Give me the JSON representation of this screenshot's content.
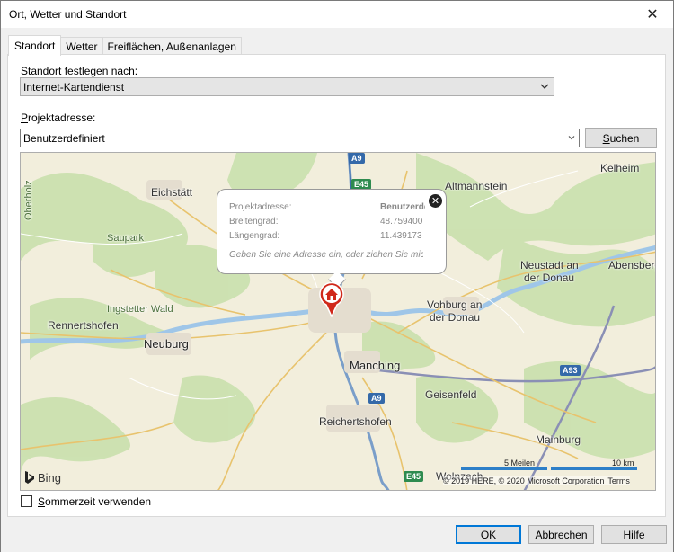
{
  "window": {
    "title": "Ort, Wetter und Standort",
    "close_glyph": "✕"
  },
  "tabs": [
    {
      "label": "Standort",
      "active": true
    },
    {
      "label": "Wetter",
      "active": false
    },
    {
      "label": "Freiflächen, Außenanlagen",
      "active": false
    }
  ],
  "location_method": {
    "label": "Standort festlegen nach:",
    "value": "Internet-Kartendienst"
  },
  "project_address": {
    "label_prefix": "P",
    "label_rest": "rojektadresse:",
    "value": "Benutzerdefiniert",
    "search_button_prefix": "S",
    "search_button_rest": "uchen"
  },
  "map": {
    "provider": "Bing",
    "places": {
      "eichstaett": "Eichstätt",
      "saupark": "Saupark",
      "oberholz": "Oberholz",
      "ingstetter_wald": "Ingstetter Wald",
      "rennertshofen": "Rennertshofen",
      "neuburg": "Neuburg",
      "altmannstein": "Altmannstein",
      "kelheim": "Kelheim",
      "neustadt_1": "Neustadt an",
      "neustadt_2": "der Donau",
      "abensberg": "Abensberg",
      "vohburg_1": "Vohburg an",
      "vohburg_2": "der Donau",
      "manching": "Manching",
      "geisenfeld": "Geisenfeld",
      "reichertshofen": "Reichertshofen",
      "mainburg": "Mainburg",
      "wolnzach": "Wolnzach"
    },
    "shields": {
      "a9_top": "A9",
      "e45_top": "E45",
      "a9_mid": "A9",
      "a9_low": "A9",
      "a93": "A93",
      "e45_bottom": "E45"
    },
    "popup": {
      "address_label": "Projektadresse:",
      "address_value": "Benutzerdefiniert",
      "lat_label": "Breitengrad:",
      "lat_value": "48.759400",
      "lon_label": "Längengrad:",
      "lon_value": "11.439173",
      "hint": "Geben Sie eine Adresse ein, oder ziehen Sie mich",
      "close_glyph": "✕"
    },
    "scale": {
      "miles": "5 Meilen",
      "km": "10 km"
    },
    "copyright": "© 2019 HERE, © 2020 Microsoft Corporation",
    "terms": "Terms"
  },
  "dst": {
    "label_prefix": "S",
    "label_rest": "ommerzeit verwenden",
    "checked": false
  },
  "buttons": {
    "ok": "OK",
    "cancel": "Abbrechen",
    "help": "Hilfe"
  }
}
